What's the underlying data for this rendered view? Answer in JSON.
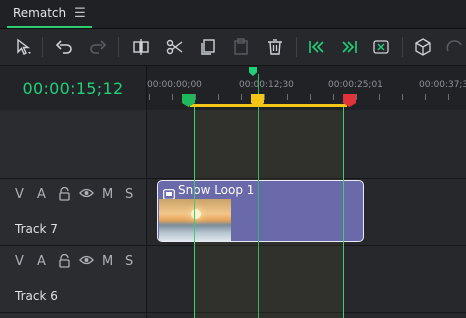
{
  "tab": {
    "label": "Rematch",
    "menu_icon": "hamburger-icon"
  },
  "toolbar": {
    "icons": [
      "select-arrow-icon",
      "undo-icon",
      "redo-icon",
      "split-icon",
      "scissors-icon",
      "copy-icon",
      "paste-icon",
      "delete-icon",
      "jump-start-icon",
      "jump-end-icon",
      "fit-icon",
      "3d-box-icon",
      "rotate-icon"
    ]
  },
  "timecode": "00:00:15;12",
  "ruler": {
    "labels": [
      "00:00:00;00",
      "00:00:12;30",
      "00:00:25;01",
      "00:00:37;3"
    ]
  },
  "track_controls": {
    "video": "V",
    "audio": "A",
    "mute": "M",
    "solo": "S"
  },
  "tracks": [
    {
      "name": "Track 7"
    },
    {
      "name": "Track 6"
    }
  ],
  "clip": {
    "title": "Snow Loop 1"
  },
  "colors": {
    "accent": "#21d07a",
    "in_marker": "#1fb85b",
    "playhead": "#f5c518",
    "out_marker": "#e0333a",
    "clip": "#6a6aaa"
  }
}
